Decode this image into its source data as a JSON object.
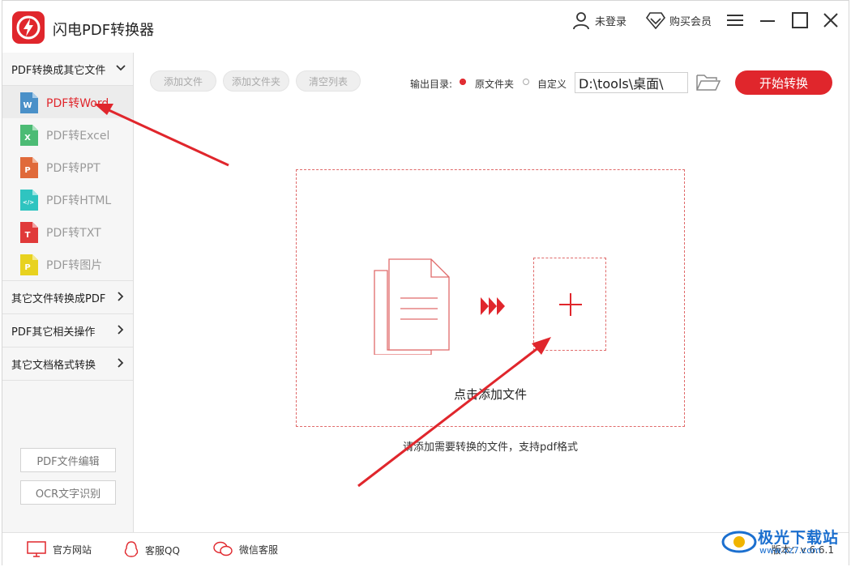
{
  "app": {
    "title": "闪电PDF转换器",
    "accent": "#e0262c"
  },
  "header": {
    "login": "未登录",
    "vip": "购买会员"
  },
  "sidebar": {
    "category1": "PDF转换成其它文件",
    "items": [
      {
        "label": "PDF转Word",
        "icon": "word-file-icon",
        "letter": "W",
        "color": "#4a90c8",
        "active": true
      },
      {
        "label": "PDF转Excel",
        "icon": "excel-file-icon",
        "letter": "X",
        "color": "#4cbb74",
        "active": false
      },
      {
        "label": "PDF转PPT",
        "icon": "ppt-file-icon",
        "letter": "P",
        "color": "#e06a3a",
        "active": false
      },
      {
        "label": "PDF转HTML",
        "icon": "html-file-icon",
        "letter": "</>",
        "color": "#2fc4c0",
        "active": false
      },
      {
        "label": "PDF转TXT",
        "icon": "txt-file-icon",
        "letter": "T",
        "color": "#e03a3a",
        "active": false
      },
      {
        "label": "PDF转图片",
        "icon": "image-file-icon",
        "letter": "P",
        "color": "#e8d21f",
        "active": false
      }
    ],
    "category2": "其它文件转换成PDF",
    "category3": "PDF其它相关操作",
    "category4": "其它文档格式转换",
    "edit_button": "PDF文件编辑",
    "ocr_button": "OCR文字识别"
  },
  "toolbar": {
    "add_file": "添加文件",
    "add_folder": "添加文件夹",
    "clear_list": "清空列表",
    "output_label": "输出目录:",
    "option_original": "原文件夹",
    "option_custom": "自定义",
    "path": "D:\\tools\\桌面\\",
    "start": "开始转换"
  },
  "dropzone": {
    "text": "点击添加文件",
    "hint": "请添加需要转换的文件，支持pdf格式"
  },
  "bottom": {
    "website": "官方网站",
    "qq": "客服QQ",
    "wechat": "微信客服",
    "version": "版本：v 6.6.1"
  },
  "watermark": {
    "text": "极光下载站",
    "sub": "www.xz7.com"
  }
}
